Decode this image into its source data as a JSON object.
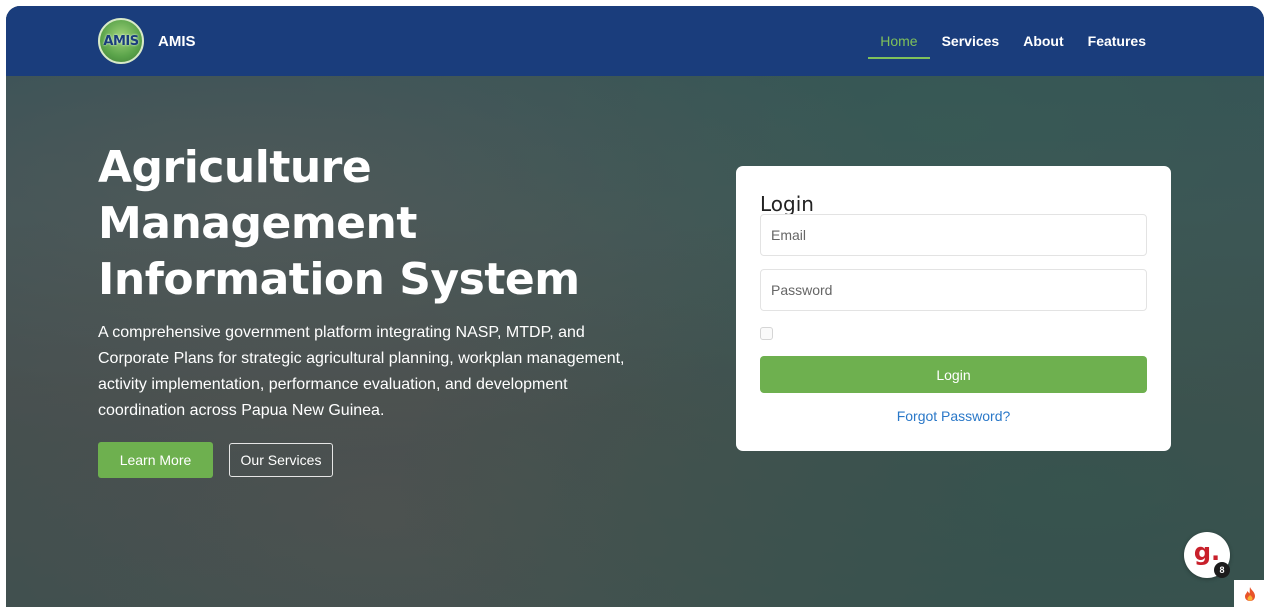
{
  "brand": {
    "name": "AMIS",
    "logo_text": "AMIS"
  },
  "nav": [
    {
      "label": "Home",
      "active": true
    },
    {
      "label": "Services",
      "active": false
    },
    {
      "label": "About",
      "active": false
    },
    {
      "label": "Features",
      "active": false
    }
  ],
  "hero": {
    "title_line1": "Agriculture",
    "title_line2": "Management",
    "title_line3": "Information System",
    "description": "A comprehensive government platform integrating NASP, MTDP, and Corporate Plans for strategic agricultural planning, workplan management, activity implementation, performance evaluation, and development coordination across Papua New Guinea.",
    "learn_more_label": "Learn More",
    "our_services_label": "Our Services"
  },
  "login": {
    "title": "Login",
    "email_placeholder": "Email",
    "password_placeholder": "Password",
    "submit_label": "Login",
    "forgot_label": "Forgot Password?"
  },
  "widgets": {
    "g_letter": "g.",
    "g_badge": "8"
  },
  "colors": {
    "navbar": "#1a3d7c",
    "accent_green": "#6eb04f",
    "nav_active": "#7fc15a",
    "link_blue": "#2a78c8"
  }
}
